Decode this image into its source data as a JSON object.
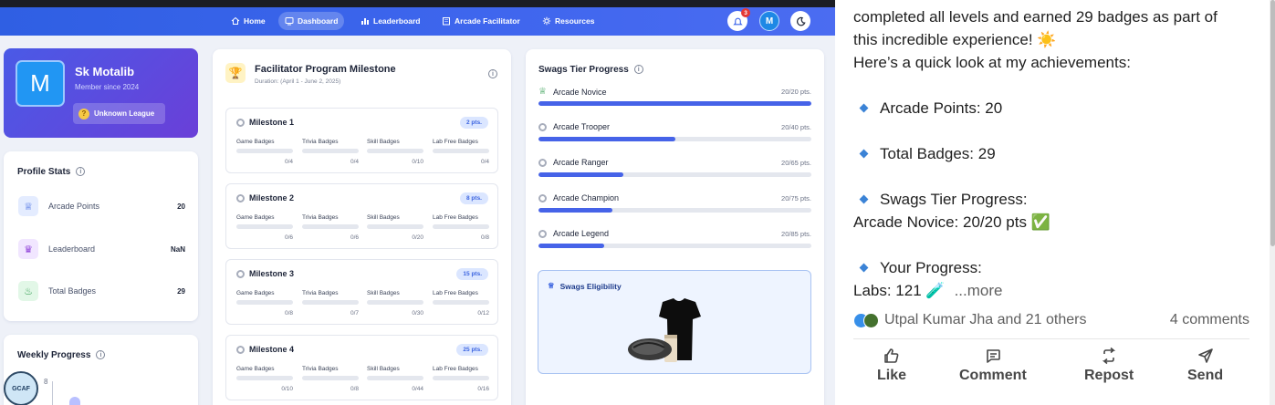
{
  "nav": {
    "items": [
      {
        "label": "Home",
        "icon": "home-icon"
      },
      {
        "label": "Dashboard",
        "icon": "dashboard-icon"
      },
      {
        "label": "Leaderboard",
        "icon": "bar-chart-icon"
      },
      {
        "label": "Arcade Facilitator",
        "icon": "building-icon"
      },
      {
        "label": "Resources",
        "icon": "gear-icon"
      }
    ],
    "notification_count": "3",
    "user_initial": "M"
  },
  "profile": {
    "initial": "M",
    "name": "Sk Motalib",
    "member_since": "Member since 2024",
    "league": "Unknown League"
  },
  "profile_stats": {
    "title": "Profile Stats",
    "rows": [
      {
        "label": "Arcade Points",
        "value": "20",
        "icon": "trophy-icon"
      },
      {
        "label": "Leaderboard",
        "value": "NaN",
        "icon": "crown-icon"
      },
      {
        "label": "Total Badges",
        "value": "29",
        "icon": "flame-icon"
      }
    ]
  },
  "weekly": {
    "title": "Weekly Progress",
    "tick": "8"
  },
  "milestones": {
    "title": "Facilitator Program Milestone",
    "duration": "Duration: (April 1 - June 2, 2025)",
    "columns": [
      "Game Badges",
      "Trivia Badges",
      "Skill Badges",
      "Lab Free Badges"
    ],
    "items": [
      {
        "name": "Milestone 1",
        "points": "2 pts.",
        "values": [
          "0/4",
          "0/4",
          "0/10",
          "0/4"
        ]
      },
      {
        "name": "Milestone 2",
        "points": "8 pts.",
        "values": [
          "0/6",
          "0/6",
          "0/20",
          "0/8"
        ]
      },
      {
        "name": "Milestone 3",
        "points": "15 pts.",
        "values": [
          "0/8",
          "0/7",
          "0/30",
          "0/12"
        ]
      },
      {
        "name": "Milestone 4",
        "points": "25 pts.",
        "values": [
          "0/10",
          "0/8",
          "0/44",
          "0/16"
        ]
      }
    ]
  },
  "swags": {
    "title": "Swags Tier Progress",
    "tiers": [
      {
        "name": "Arcade Novice",
        "points": "20/20 pts.",
        "progress": 1.0
      },
      {
        "name": "Arcade Trooper",
        "points": "20/40 pts.",
        "progress": 0.5
      },
      {
        "name": "Arcade Ranger",
        "points": "20/65 pts.",
        "progress": 0.31
      },
      {
        "name": "Arcade Champion",
        "points": "20/75 pts.",
        "progress": 0.27
      },
      {
        "name": "Arcade Legend",
        "points": "20/85 pts.",
        "progress": 0.24
      }
    ],
    "eligibility_title": "Swags Eligibility"
  },
  "post": {
    "lines": [
      "completed all levels and earned 29 badges as part of",
      "this incredible experience! ☀️",
      "Here’s a quick look at my achievements:"
    ],
    "bullets": [
      "Arcade Points: 20",
      "Total Badges: 29",
      "Swags Tier Progress:",
      "Your Progress:"
    ],
    "tier_line": "Arcade Novice: 20/20 pts ✅",
    "labs_line": "Labs: 121 🧪",
    "more": "...more",
    "reactions_text": "Utpal Kumar Jha and 21 others",
    "comments": "4 comments",
    "actions": [
      "Like",
      "Comment",
      "Repost",
      "Send"
    ]
  },
  "colors": {
    "nav_blue": "#3a63ea",
    "progress_blue": "#4663e8",
    "profile_gradient_start": "#4a5ae6",
    "profile_gradient_end": "#6a3fd8",
    "bullet_blue": "#3b83d6"
  }
}
